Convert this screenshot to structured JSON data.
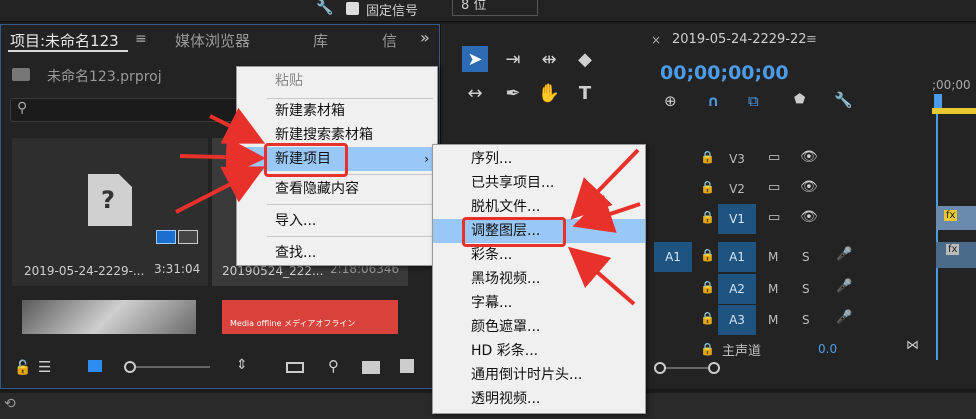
{
  "top": {
    "checkbox_label": "固定信号",
    "bit_value": "8 位"
  },
  "project": {
    "tabs": [
      "项目:未命名123",
      "媒体浏览器",
      "库",
      "信"
    ],
    "file_name": "未命名123.prproj",
    "items": [
      {
        "name": "2019-05-24-2229-...",
        "duration": "3:31:04"
      },
      {
        "name": "20190524_222...",
        "duration": "2:18:06346"
      }
    ],
    "offline_text": "Media offline メディアオフライン"
  },
  "context_menu": {
    "items": [
      "粘贴",
      "新建素材箱",
      "新建搜索素材箱",
      "新建项目",
      "查看隐藏内容",
      "导入...",
      "查找..."
    ]
  },
  "submenu": {
    "items": [
      "序列...",
      "已共享项目...",
      "脱机文件...",
      "调整图层...",
      "彩条...",
      "黑场视频...",
      "字幕...",
      "颜色遮罩...",
      "HD 彩条...",
      "通用倒计时片头...",
      "透明视频..."
    ]
  },
  "timeline": {
    "tab_title": "2019-05-24-2229-22",
    "timecode": "00;00;00;00",
    "ruler_time": ";00;00",
    "video_tracks": [
      "V3",
      "V2",
      "V1"
    ],
    "audio_tracks": [
      "A1",
      "A2",
      "A3"
    ],
    "source_track": "A1",
    "mute": "M",
    "solo": "S",
    "master_label": "主声道",
    "master_value": "0.0",
    "fx": "fx"
  },
  "colors": {
    "accent": "#2d6cb5",
    "timecode": "#4c9be8",
    "highlight": "#99c8f6",
    "annotation": "#e8312b"
  }
}
